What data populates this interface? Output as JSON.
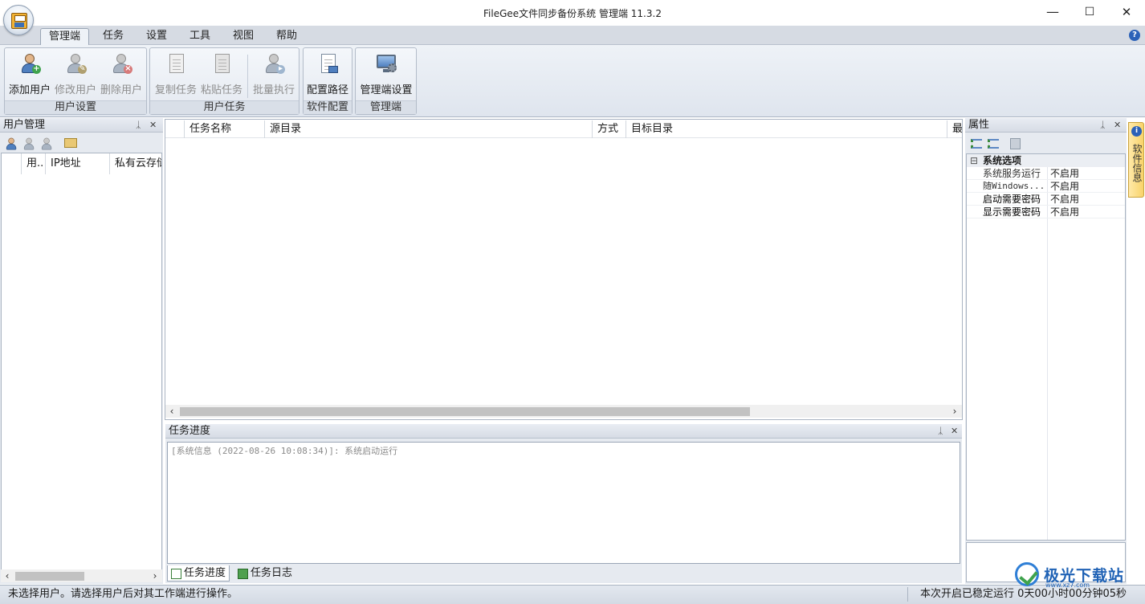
{
  "window": {
    "title": "FileGee文件同步备份系统 管理端 11.3.2",
    "minimize": "—",
    "maximize": "☐",
    "close": "✕"
  },
  "ribbon_tabs": [
    {
      "label": "管理端",
      "active": true
    },
    {
      "label": "任务"
    },
    {
      "label": "设置"
    },
    {
      "label": "工具"
    },
    {
      "label": "视图"
    },
    {
      "label": "帮助"
    }
  ],
  "help_glyph": "?",
  "ribbon_groups": {
    "user_settings": {
      "label": "用户设置",
      "buttons": [
        {
          "label": "添加用户",
          "enabled": true,
          "icon": "add-user-icon"
        },
        {
          "label": "修改用户",
          "enabled": false,
          "icon": "edit-user-icon"
        },
        {
          "label": "删除用户",
          "enabled": false,
          "icon": "delete-user-icon"
        }
      ]
    },
    "user_tasks": {
      "label": "用户任务",
      "buttons": [
        {
          "label": "复制任务",
          "enabled": false,
          "icon": "copy-task-icon"
        },
        {
          "label": "粘贴任务",
          "enabled": false,
          "icon": "paste-task-icon"
        },
        {
          "label": "批量执行",
          "enabled": false,
          "icon": "batch-run-icon"
        }
      ]
    },
    "software_config": {
      "label": "软件配置",
      "buttons": [
        {
          "label": "配置路径",
          "enabled": true,
          "icon": "config-path-icon"
        }
      ]
    },
    "admin": {
      "label": "管理端",
      "buttons": [
        {
          "label": "管理端设置",
          "enabled": true,
          "icon": "admin-settings-icon"
        }
      ]
    }
  },
  "left_panel": {
    "title": "用户管理",
    "pin": "ᛣ",
    "close": "✕",
    "columns": [
      "用..",
      "IP地址",
      "私有云存储"
    ]
  },
  "task_list": {
    "columns": [
      "任务名称",
      "源目录",
      "方式",
      "目标目录",
      "最"
    ]
  },
  "progress_panel": {
    "title": "任务进度",
    "pin": "ᛣ",
    "close": "✕",
    "log_lines": [
      "[系统信息 (2022-08-26 10:08:34)]: 系统启动运行"
    ],
    "tabs": [
      {
        "label": "任务进度",
        "active": true
      },
      {
        "label": "任务日志"
      }
    ]
  },
  "properties_panel": {
    "title": "属性",
    "pin": "ᛣ",
    "close": "✕",
    "category": "系统选项",
    "collapse_glyph": "⊟",
    "rows": [
      {
        "name": "系统服务运行",
        "value": "不启用",
        "bold": false
      },
      {
        "name": "随Windows...",
        "value": "不启用",
        "bold": false
      },
      {
        "name": "启动需要密码",
        "value": "不启用",
        "bold": true
      },
      {
        "name": "显示需要密码",
        "value": "不启用",
        "bold": true
      }
    ]
  },
  "side_tab": {
    "label": "软件信息",
    "glyph": "i"
  },
  "scroll": {
    "left": "‹",
    "right": "›"
  },
  "status": {
    "left": "未选择用户。请选择用户后对其工作端进行操作。",
    "right": "本次开启已稳定运行 0天00小时00分钟05秒"
  },
  "watermark": {
    "text": "极光下载站",
    "sub": "www.xz7.com"
  },
  "colors": {
    "accent": "#2c62b8",
    "panel_bg": "#e6eaf0",
    "ribbon_bg": "#dfe5ee",
    "disabled_text": "#8d8d8d"
  }
}
